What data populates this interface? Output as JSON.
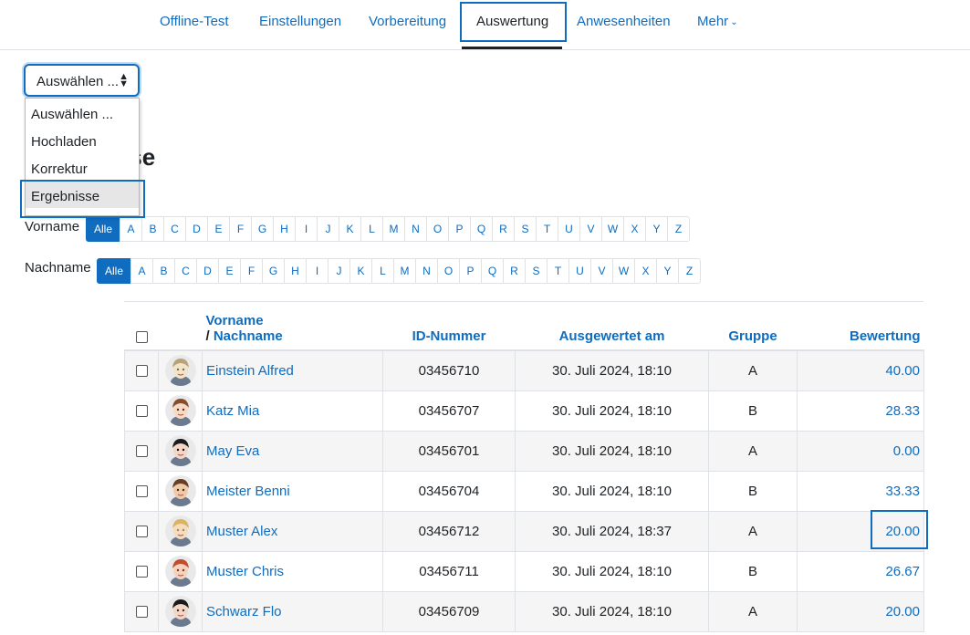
{
  "nav": {
    "tabs": [
      {
        "label": "Offline-Test"
      },
      {
        "label": "Einstellungen"
      },
      {
        "label": "Vorbereitung"
      },
      {
        "label": "Auswertung"
      },
      {
        "label": "Anwesenheiten"
      },
      {
        "label": "Mehr"
      }
    ],
    "active": "Auswertung"
  },
  "select": {
    "value": "Auswählen ...",
    "options": [
      "Auswählen ...",
      "Hochladen",
      "Korrektur",
      "Ergebnisse"
    ],
    "highlighted": "Ergebnisse"
  },
  "heading": "se",
  "filters": {
    "firstname_label": "Vorname",
    "lastname_label": "Nachname",
    "all_label": "Alle",
    "letters": [
      "A",
      "B",
      "C",
      "D",
      "E",
      "F",
      "G",
      "H",
      "I",
      "J",
      "K",
      "L",
      "M",
      "N",
      "O",
      "P",
      "Q",
      "R",
      "S",
      "T",
      "U",
      "V",
      "W",
      "X",
      "Y",
      "Z"
    ]
  },
  "table": {
    "headers": {
      "firstname": "Vorname",
      "slash": "/ ",
      "lastname": "Nachname",
      "idnumber": "ID-Nummer",
      "evaluated": "Ausgewertet am",
      "group": "Gruppe",
      "grade": "Bewertung"
    },
    "rows": [
      {
        "name": "Einstein Alfred",
        "id": "03456710",
        "date": "30. Juli 2024, 18:10",
        "group": "A",
        "grade": "40.00"
      },
      {
        "name": "Katz Mia",
        "id": "03456707",
        "date": "30. Juli 2024, 18:10",
        "group": "B",
        "grade": "28.33"
      },
      {
        "name": "May Eva",
        "id": "03456701",
        "date": "30. Juli 2024, 18:10",
        "group": "A",
        "grade": "0.00"
      },
      {
        "name": "Meister Benni",
        "id": "03456704",
        "date": "30. Juli 2024, 18:10",
        "group": "B",
        "grade": "33.33"
      },
      {
        "name": "Muster Alex",
        "id": "03456712",
        "date": "30. Juli 2024, 18:37",
        "group": "A",
        "grade": "20.00"
      },
      {
        "name": "Muster Chris",
        "id": "03456711",
        "date": "30. Juli 2024, 18:10",
        "group": "B",
        "grade": "26.67"
      },
      {
        "name": "Schwarz Flo",
        "id": "03456709",
        "date": "30. Juli 2024, 18:10",
        "group": "A",
        "grade": "20.00"
      }
    ]
  },
  "colors": {
    "link": "#0f6cbf",
    "highlight": "#0f6cbf",
    "text": "#1d2125"
  }
}
